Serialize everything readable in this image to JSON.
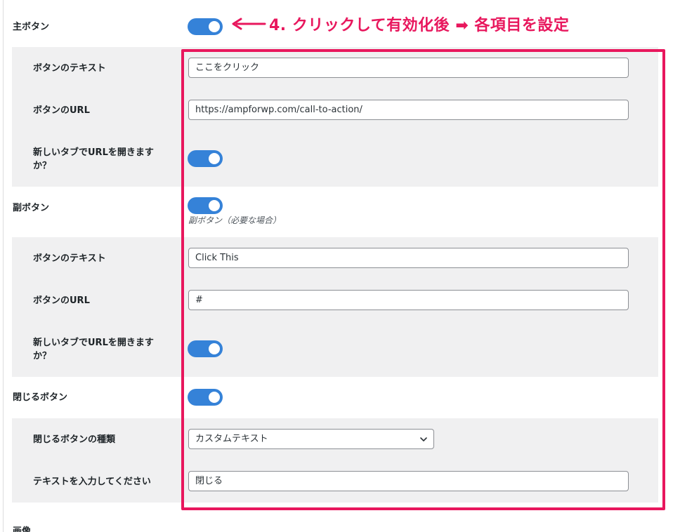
{
  "main_button": {
    "label": "主ボタン",
    "enabled": true,
    "text_label": "ボタンのテキスト",
    "text_value": "ここをクリック",
    "url_label": "ボタンのURL",
    "url_value": "https://ampforwp.com/call-to-action/",
    "newtab_label_line1": "新しいタブでURLを開きます",
    "newtab_label_line2": "か？",
    "newtab_enabled": true
  },
  "sub_button": {
    "label": "副ボタン",
    "enabled": true,
    "description": "副ボタン（必要な場合）",
    "text_label": "ボタンのテキスト",
    "text_value": "Click This",
    "url_label": "ボタンのURL",
    "url_value": "#",
    "newtab_label_line1": "新しいタブでURLを開きます",
    "newtab_label_line2": "か？",
    "newtab_enabled": true
  },
  "close_button": {
    "label": "閉じるボタン",
    "enabled": true,
    "type_label": "閉じるボタンの種類",
    "type_value": "カスタムテキスト",
    "text_label": "テキストを入力してください",
    "text_value": "閉じる"
  },
  "annotation": {
    "text": "4. クリックして有効化後 ➡ 各項目を設定",
    "color": "#e8175d"
  },
  "next_section_label": "画像",
  "colors": {
    "toggle_on": "#3582d8",
    "highlight": "#e8175d",
    "sub_bg": "#f0f0f1"
  }
}
